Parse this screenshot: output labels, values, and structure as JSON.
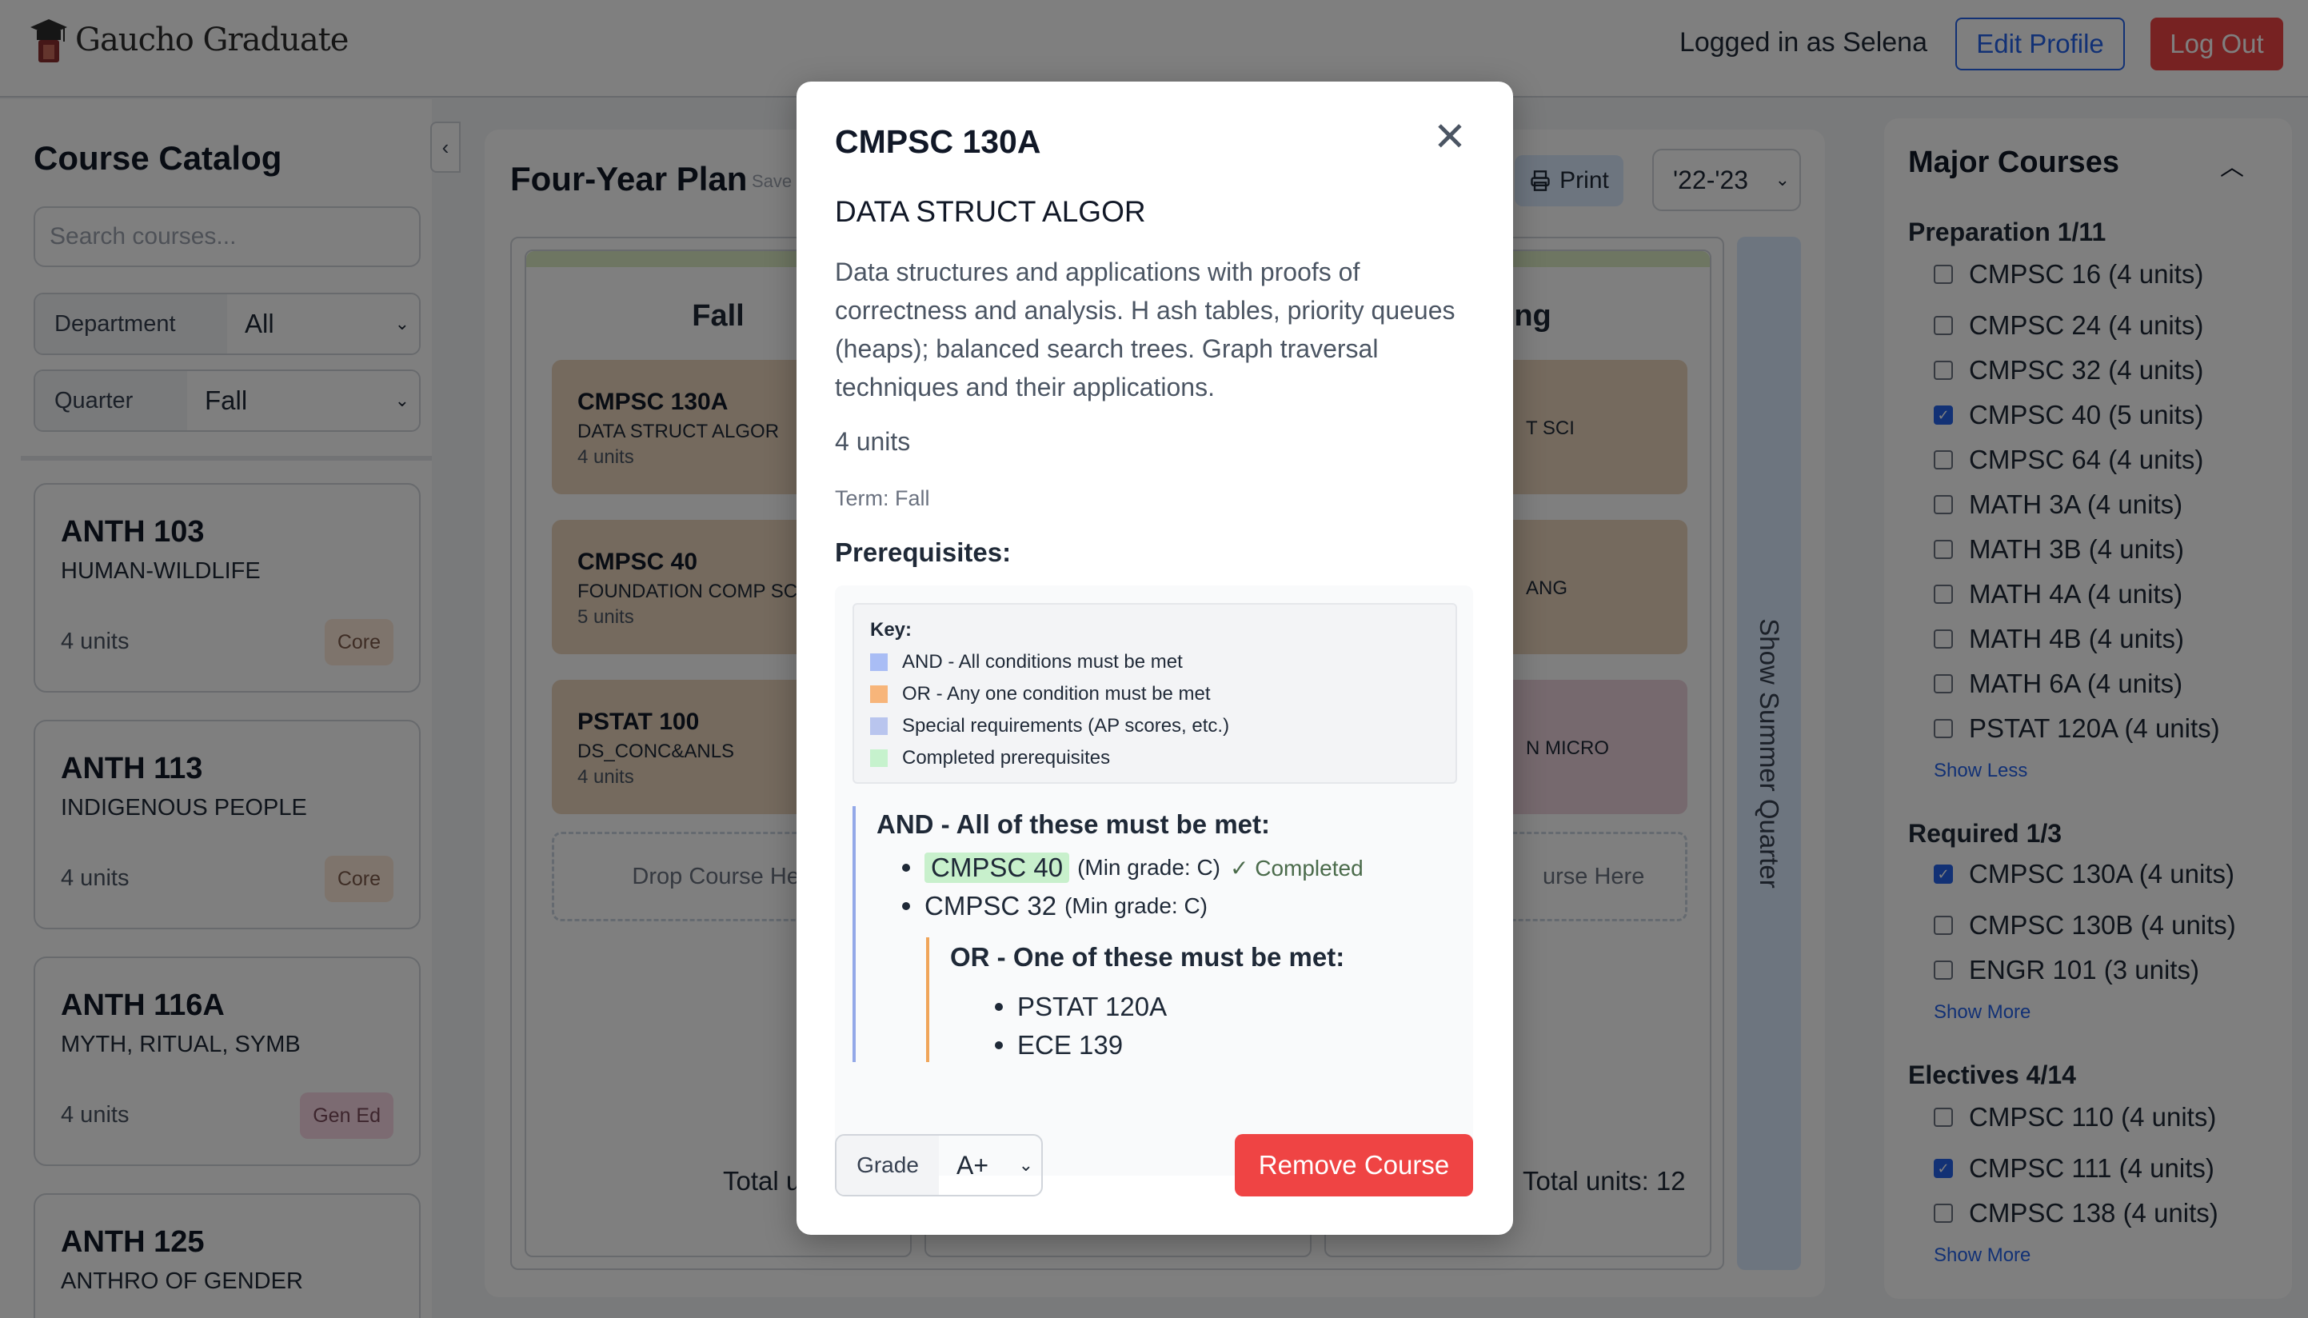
{
  "header": {
    "app_name": "Gaucho Graduate",
    "logged_in_text": "Logged in as Selena",
    "edit_profile": "Edit Profile",
    "log_out": "Log Out"
  },
  "catalog": {
    "title": "Course Catalog",
    "search_placeholder": "Search courses...",
    "department_label": "Department",
    "department_value": "All",
    "quarter_label": "Quarter",
    "quarter_value": "Fall",
    "courses": [
      {
        "code": "ANTH 103",
        "name": "HUMAN-WILDLIFE",
        "units": "4 units",
        "tag": "Core"
      },
      {
        "code": "ANTH 113",
        "name": "INDIGENOUS PEOPLE",
        "units": "4 units",
        "tag": "Core"
      },
      {
        "code": "ANTH 116A",
        "name": "MYTH, RITUAL, SYMB",
        "units": "4 units",
        "tag": "Gen Ed"
      },
      {
        "code": "ANTH 125",
        "name": "ANTHRO OF GENDER",
        "units": "",
        "tag": ""
      }
    ]
  },
  "plan": {
    "title": "Four-Year Plan",
    "saved_text": "Save",
    "print_label": "Print",
    "year": "'22-'23",
    "summer_label": "Show Summer Quarter",
    "fall": {
      "title": "Fall",
      "cards": [
        {
          "code": "CMPSC 130A",
          "name": "DATA STRUCT ALGOR",
          "units": "4 units"
        },
        {
          "code": "CMPSC 40",
          "name": "FOUNDATION COMP SC",
          "units": "5 units"
        },
        {
          "code": "PSTAT 100",
          "name": "DS_CONC&ANLS",
          "units": "4 units"
        }
      ],
      "drop": "Drop Course Her",
      "total": "Total u"
    },
    "spring": {
      "title": "ring",
      "cards": [
        {
          "name": "T SCI"
        },
        {
          "name": "ANG"
        },
        {
          "name": "N MICRO"
        }
      ],
      "drop": "urse Here",
      "total": "Total units: 12"
    }
  },
  "major": {
    "title": "Major Courses",
    "preparation": {
      "title": "Preparation 1/11",
      "items": [
        {
          "label": "CMPSC 16 (4 units)",
          "checked": false
        },
        {
          "label": "CMPSC 24 (4 units)",
          "checked": false
        },
        {
          "label": "CMPSC 32 (4 units)",
          "checked": false
        },
        {
          "label": "CMPSC 40 (5 units)",
          "checked": true
        },
        {
          "label": "CMPSC 64 (4 units)",
          "checked": false
        },
        {
          "label": "MATH 3A (4 units)",
          "checked": false
        },
        {
          "label": "MATH 3B (4 units)",
          "checked": false
        },
        {
          "label": "MATH 4A (4 units)",
          "checked": false
        },
        {
          "label": "MATH 4B (4 units)",
          "checked": false
        },
        {
          "label": "MATH 6A (4 units)",
          "checked": false
        },
        {
          "label": "PSTAT 120A (4 units)",
          "checked": false
        }
      ],
      "toggle": "Show Less"
    },
    "required": {
      "title": "Required 1/3",
      "items": [
        {
          "label": "CMPSC 130A (4 units)",
          "checked": true
        },
        {
          "label": "CMPSC 130B (4 units)",
          "checked": false
        },
        {
          "label": "ENGR 101 (3 units)",
          "checked": false
        }
      ],
      "toggle": "Show More"
    },
    "electives": {
      "title": "Electives 4/14",
      "items": [
        {
          "label": "CMPSC 110 (4 units)",
          "checked": false
        },
        {
          "label": "CMPSC 111 (4 units)",
          "checked": true
        },
        {
          "label": "CMPSC 138 (4 units)",
          "checked": false
        }
      ],
      "toggle": "Show More"
    }
  },
  "modal": {
    "code": "CMPSC 130A",
    "title": "DATA STRUCT ALGOR",
    "description": "Data structures and applications with proofs of correctness and analysis. H ash tables, priority queues (heaps); balanced search trees. Graph traversal techniques and their applications.",
    "units": "4 units",
    "term": "Term: Fall",
    "prereq_title": "Prerequisites:",
    "key": {
      "title": "Key:",
      "items": [
        {
          "label": "AND - All conditions must be met",
          "color": "#a9bdf5"
        },
        {
          "label": "OR - Any one condition must be met",
          "color": "#f7b57a"
        },
        {
          "label": "Special requirements (AP scores, etc.)",
          "color": "#b9c5ee"
        },
        {
          "label": "Completed prerequisites",
          "color": "#c6f2cd"
        }
      ]
    },
    "and_heading": "AND - All of these must be met:",
    "and_items": [
      {
        "course": "CMPSC 40",
        "grade": "(Min grade: C)",
        "status": "✓ Completed"
      },
      {
        "course": "CMPSC 32",
        "grade": "(Min grade: C)",
        "status": ""
      }
    ],
    "or_heading": "OR - One of these must be met:",
    "or_items": [
      "PSTAT 120A",
      "ECE 139"
    ],
    "grade_label": "Grade",
    "grade_value": "A+",
    "remove_label": "Remove Course"
  }
}
